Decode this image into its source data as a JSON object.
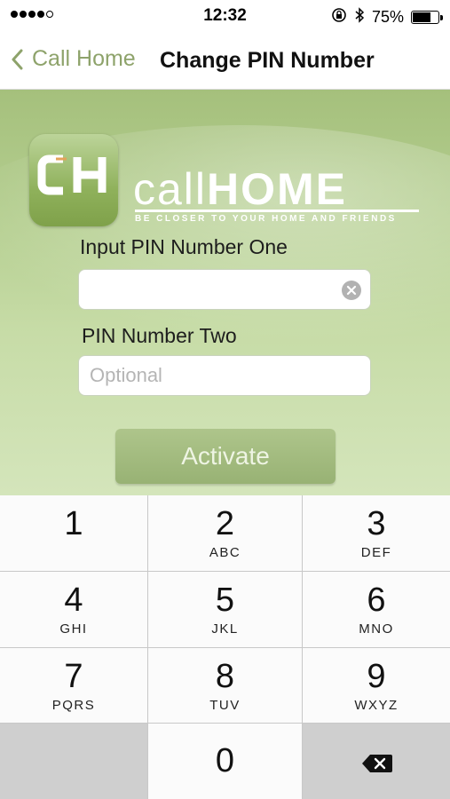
{
  "status": {
    "time": "12:32",
    "battery_percent": "75%",
    "battery_level": 0.75,
    "signal_bars_filled": 4,
    "signal_bars_total": 5
  },
  "nav": {
    "back_label": "Call Home",
    "title": "Change PIN Number"
  },
  "logo": {
    "icon_letters": "CH",
    "word_call": "call",
    "word_home": "HOME",
    "tagline": "BE CLOSER TO YOUR HOME AND FRIENDS"
  },
  "form": {
    "pin_one_label": "Input PIN Number One",
    "pin_one_value": "",
    "pin_two_label": "PIN Number Two",
    "pin_two_placeholder": "Optional",
    "activate_label": "Activate"
  },
  "keypad": {
    "keys": [
      {
        "num": "1",
        "letters": ""
      },
      {
        "num": "2",
        "letters": "ABC"
      },
      {
        "num": "3",
        "letters": "DEF"
      },
      {
        "num": "4",
        "letters": "GHI"
      },
      {
        "num": "5",
        "letters": "JKL"
      },
      {
        "num": "6",
        "letters": "MNO"
      },
      {
        "num": "7",
        "letters": "PQRS"
      },
      {
        "num": "8",
        "letters": "TUV"
      },
      {
        "num": "9",
        "letters": "WXYZ"
      },
      {
        "num": "0",
        "letters": ""
      }
    ],
    "delete_icon": "backspace-icon"
  },
  "colors": {
    "accent_green": "#8ea36b",
    "panel_green": "#b3cd8e",
    "button_green": "#98b274"
  }
}
